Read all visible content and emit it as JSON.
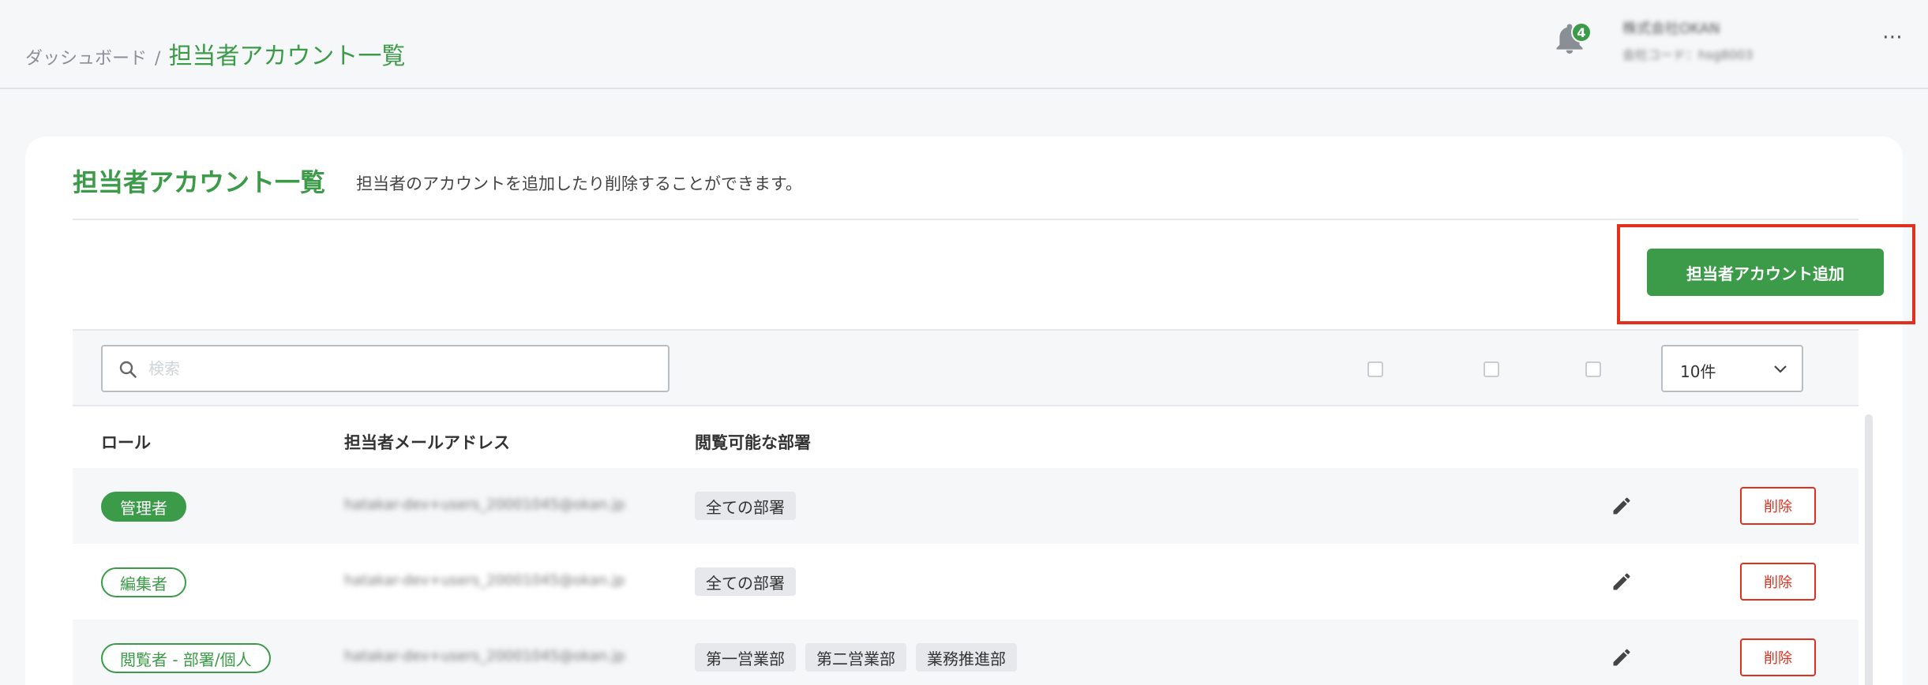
{
  "breadcrumb": {
    "parent": "ダッシュボード",
    "separator": "/",
    "current": "担当者アカウント一覧"
  },
  "notifications": {
    "count": "4"
  },
  "company": {
    "name": "株式会社OKAN",
    "code": "会社コード：hsg8003"
  },
  "more_menu": "⋯",
  "card": {
    "title": "担当者アカウント一覧",
    "description": "担当者のアカウントを追加したり削除することができます。",
    "add_button_label": "担当者アカウント追加"
  },
  "search": {
    "placeholder": "検索",
    "value": ""
  },
  "per_page": {
    "selected": "10件"
  },
  "table": {
    "columns": [
      "ロール",
      "担当者メールアドレス",
      "閲覧可能な部署"
    ],
    "rows": [
      {
        "role": "管理者",
        "email": "hatakar-dev+users_20001045@okan.jp",
        "departments": [
          "全ての部署"
        ],
        "delete_label": "削除"
      },
      {
        "role": "編集者",
        "email": "hatakar-dev+users_20001045@okan.jp",
        "departments": [
          "全ての部署"
        ],
        "delete_label": "削除"
      },
      {
        "role": "閲覧者 - 部署/個人",
        "email": "hatakar-dev+users_20001045@okan.jp",
        "departments": [
          "第一営業部",
          "第二営業部",
          "業務推進部"
        ],
        "delete_label": "削除"
      }
    ]
  },
  "colors": {
    "brand_green": "#3c9b48",
    "danger_red": "#e0301e",
    "highlight": "#e0301e"
  }
}
